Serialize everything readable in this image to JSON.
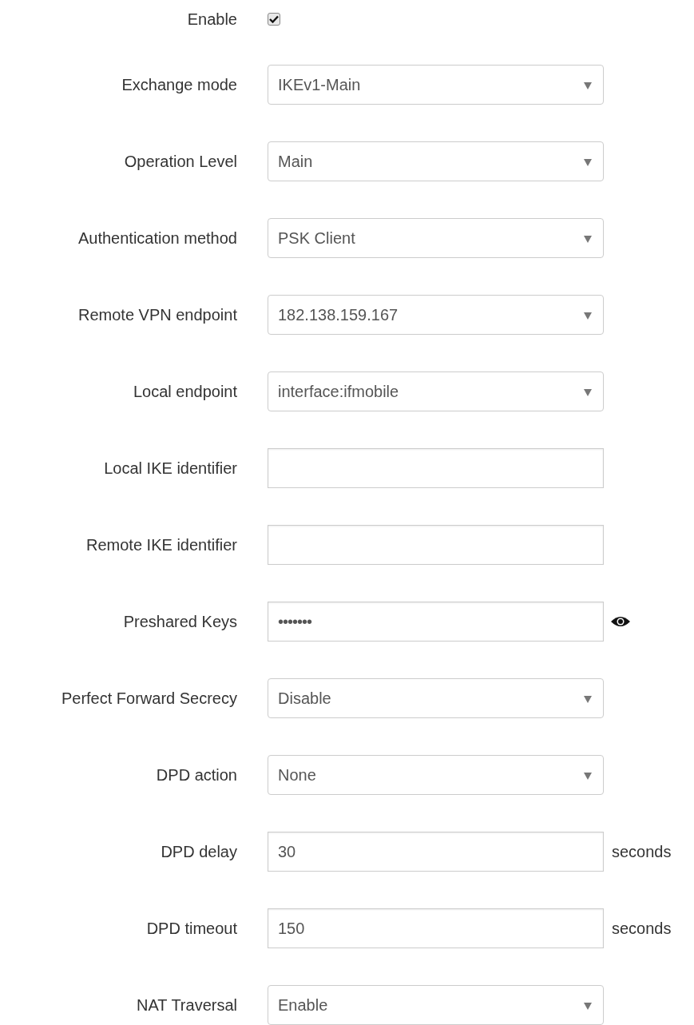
{
  "fields": [
    {
      "label": "Enable",
      "kind": "checkbox",
      "checked": true
    },
    {
      "label": "Exchange mode",
      "kind": "select",
      "value": "IKEv1-Main"
    },
    {
      "label": "Operation Level",
      "kind": "select",
      "value": "Main"
    },
    {
      "label": "Authentication method",
      "kind": "select",
      "value": "PSK Client"
    },
    {
      "label": "Remote VPN endpoint",
      "kind": "select",
      "value": "182.138.159.167"
    },
    {
      "label": "Local endpoint",
      "kind": "select",
      "value": "interface:ifmobile"
    },
    {
      "label": "Local IKE identifier",
      "kind": "text"
    },
    {
      "label": "Remote IKE identifier",
      "kind": "text"
    },
    {
      "label": "Preshared Keys",
      "kind": "password",
      "value": "•••••••"
    },
    {
      "label": "Perfect Forward Secrecy",
      "kind": "select",
      "value": "Disable"
    },
    {
      "label": "DPD action",
      "kind": "select",
      "value": "None"
    },
    {
      "label": "DPD delay",
      "kind": "text",
      "value": "30",
      "unit": "seconds"
    },
    {
      "label": "DPD timeout",
      "kind": "text",
      "value": "150",
      "unit": "seconds"
    },
    {
      "label": "NAT Traversal",
      "kind": "select",
      "value": "Enable"
    }
  ]
}
